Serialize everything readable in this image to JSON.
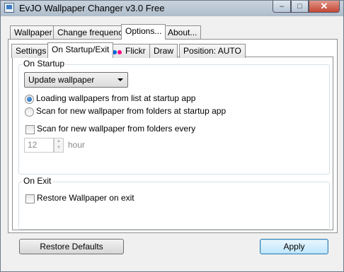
{
  "window": {
    "title": "EvJO Wallpaper Changer v3.0 Free",
    "close_glyph": "✕",
    "minimize_glyph": "–",
    "maximize_glyph": "□"
  },
  "main_tabs": [
    {
      "label": "Wallpaper"
    },
    {
      "label": "Change frequency"
    },
    {
      "label": "Options..."
    },
    {
      "label": "About..."
    }
  ],
  "sub_tabs": [
    {
      "label": "Settings"
    },
    {
      "label": "On Startup/Exit"
    },
    {
      "label": "Flickr"
    },
    {
      "label": "Draw"
    },
    {
      "label": "Position: AUTO"
    }
  ],
  "on_startup": {
    "group_label": "On Startup",
    "select_value": "Update wallpaper",
    "radio_options": [
      {
        "label": "Loading wallpapers from list at startup app",
        "checked": true
      },
      {
        "label": "Scan for new wallpaper from folders at startup app",
        "checked": false
      }
    ],
    "scan_every_label": "Scan for new wallpaper from folders every",
    "scan_every_checked": false,
    "interval_value": "12",
    "interval_unit": "hour"
  },
  "on_exit": {
    "group_label": "On Exit",
    "restore_label": "Restore Wallpaper on exit",
    "restore_checked": false
  },
  "buttons": {
    "restore_defaults": "Restore Defaults",
    "apply": "Apply"
  },
  "colors": {
    "flickr_blue": "#0063dc",
    "flickr_pink": "#ff0084",
    "accent": "#3c7fb1"
  }
}
